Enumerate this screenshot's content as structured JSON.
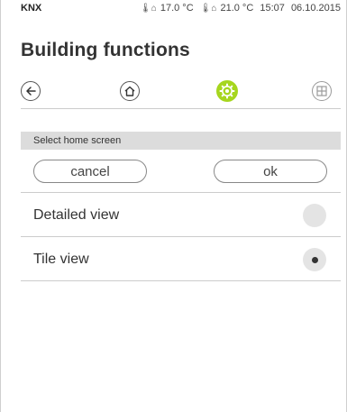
{
  "status_bar": {
    "brand": "KNX",
    "outdoor_temp": "17.0 °C",
    "indoor_temp": "21.0 °C",
    "time": "15:07",
    "date": "06.10.2015"
  },
  "page": {
    "title": "Building functions"
  },
  "nav": {
    "items": [
      {
        "icon": "back-arrow-icon"
      },
      {
        "icon": "home-icon"
      },
      {
        "icon": "gear-icon",
        "active": true,
        "color": "#a6d61e"
      },
      {
        "icon": "grid-icon"
      }
    ]
  },
  "section": {
    "header": "Select home screen"
  },
  "actions": {
    "cancel_label": "cancel",
    "ok_label": "ok"
  },
  "options": [
    {
      "label": "Detailed view",
      "selected": false
    },
    {
      "label": "Tile view",
      "selected": true
    }
  ]
}
